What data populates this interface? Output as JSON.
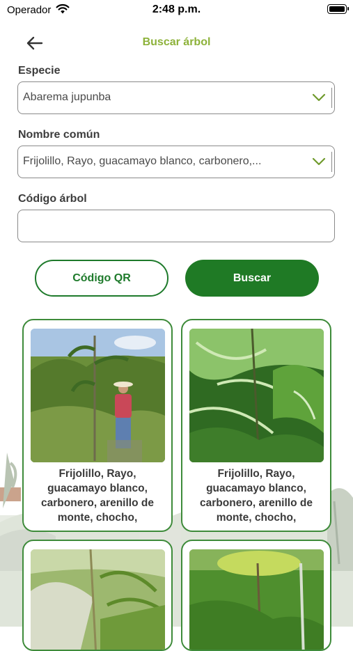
{
  "status_bar": {
    "carrier": "Operador",
    "time": "2:48 p.m."
  },
  "header": {
    "title": "Buscar árbol",
    "back_icon": "arrow-left-icon"
  },
  "form": {
    "species_label": "Especie",
    "species_value": "Abarema jupunba",
    "common_name_label": "Nombre común",
    "common_name_value": "Frijolillo, Rayo, guacamayo blanco, carbonero,...",
    "tree_code_label": "Código árbol",
    "tree_code_value": ""
  },
  "actions": {
    "qr_label": "Código QR",
    "search_label": "Buscar"
  },
  "colors": {
    "accent_light": "#8db23a",
    "accent_dark": "#1f7a25",
    "card_border": "#3e8b3a"
  },
  "results": [
    {
      "name": "Frijolillo, Rayo, guacamayo blanco, carbonero, arenillo de monte, chocho,"
    },
    {
      "name": "Frijolillo, Rayo, guacamayo blanco, carbonero, arenillo de monte, chocho,"
    },
    {
      "name": ""
    },
    {
      "name": ""
    }
  ]
}
